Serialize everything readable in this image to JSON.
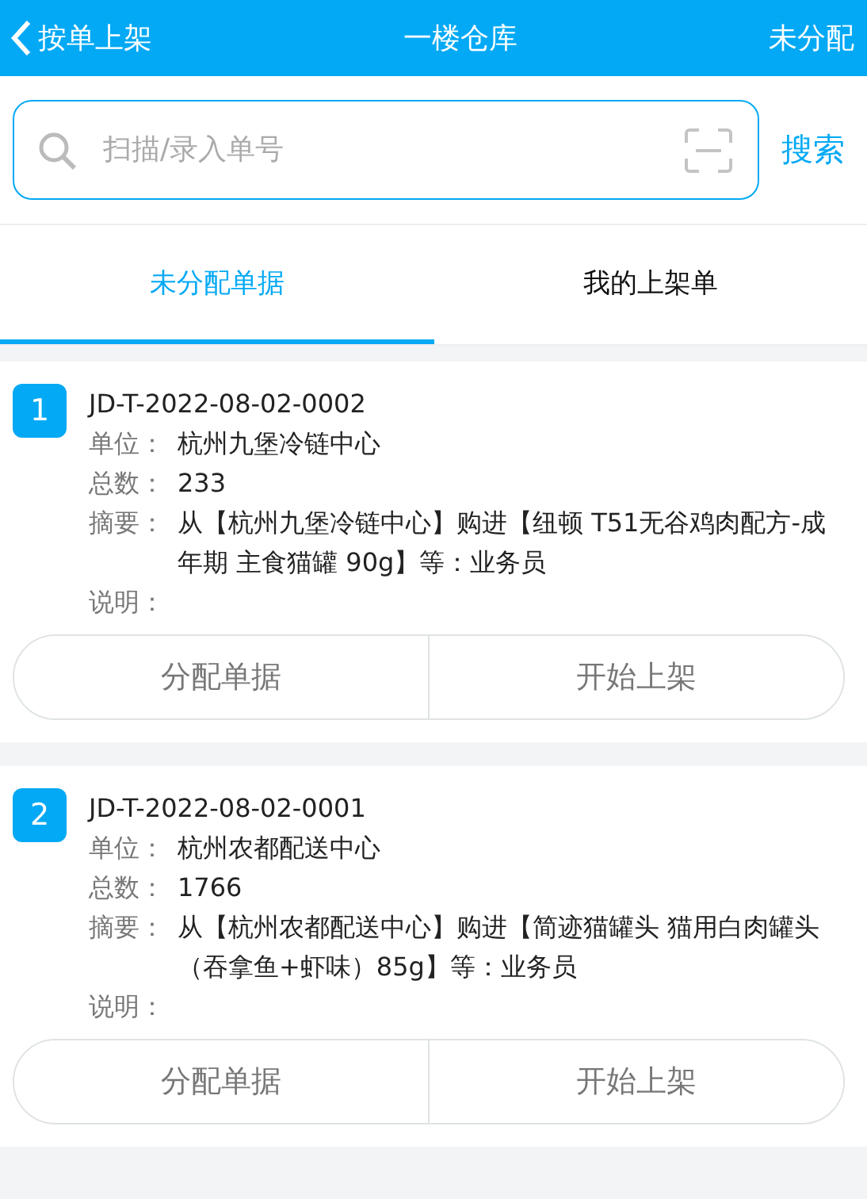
{
  "header": {
    "back_label": "按单上架",
    "title": "一楼仓库",
    "action": "未分配"
  },
  "search": {
    "placeholder": "扫描/录入单号",
    "button": "搜索"
  },
  "tabs": [
    {
      "label": "未分配单据",
      "selected": true
    },
    {
      "label": "我的上架单",
      "selected": false
    }
  ],
  "orders": [
    {
      "index": "1",
      "number": "JD-T-2022-08-02-0002",
      "fields": [
        {
          "label": "单位：",
          "value": "杭州九堡冷链中心"
        },
        {
          "label": "总数：",
          "value": "233"
        },
        {
          "label": "摘要：",
          "value": "从【杭州九堡冷链中心】购进【纽顿 T51无谷鸡肉配方-成年期 主食猫罐 90g】等：业务员"
        },
        {
          "label": "说明："
        }
      ],
      "buttons": [
        "分配单据",
        "开始上架"
      ]
    },
    {
      "index": "2",
      "number": "JD-T-2022-08-02-0001",
      "fields": [
        {
          "label": "单位：",
          "value": "杭州农都配送中心"
        },
        {
          "label": "总数：",
          "value": "1766"
        },
        {
          "label": "摘要：",
          "value": "从【杭州农都配送中心】购进【简迹猫罐头  猫用白肉罐头（吞拿鱼+虾味）85g】等：业务员"
        },
        {
          "label": "说明："
        }
      ],
      "buttons": [
        "分配单据",
        "开始上架"
      ]
    }
  ]
}
